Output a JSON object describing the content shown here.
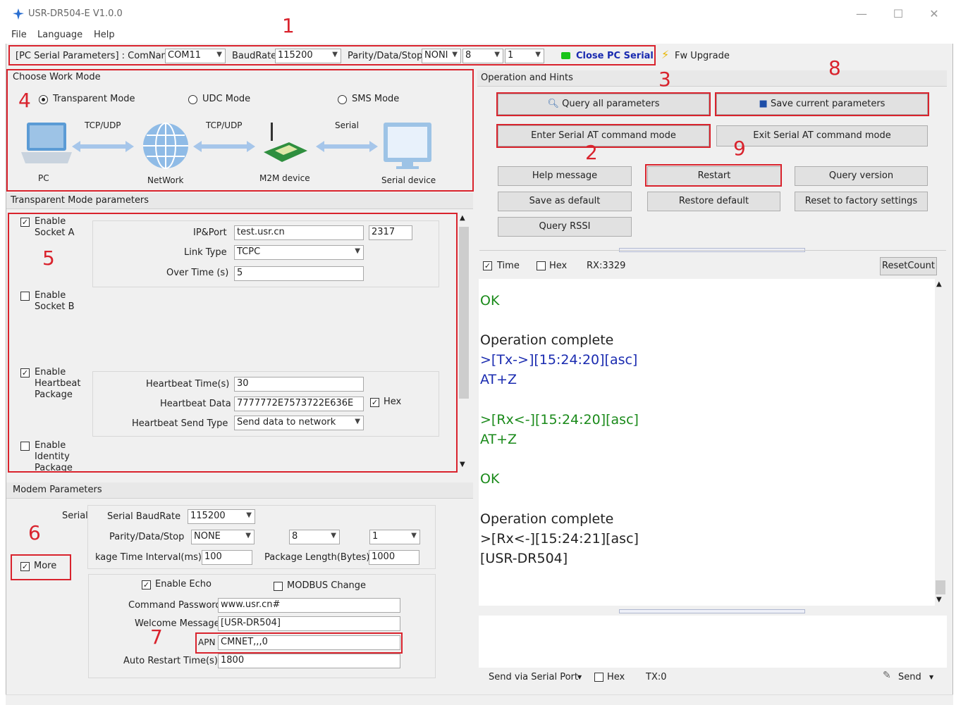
{
  "window": {
    "title": "USR-DR504-E V1.0.0",
    "min": "—",
    "max": "☐",
    "close": "✕"
  },
  "menu": [
    "File",
    "Language",
    "Help"
  ],
  "pcserial": {
    "label": "[PC Serial Parameters] : ComName",
    "comname": "COM11",
    "baud_label": "BaudRate",
    "baud": "115200",
    "pds_label": "Parity/Data/Stop",
    "parity": "NONI",
    "data": "8",
    "stop": "1",
    "close_btn": "Close PC Serial",
    "fw_upgrade": "Fw Upgrade"
  },
  "markers": [
    "1",
    "2",
    "3",
    "4",
    "5",
    "6",
    "7",
    "8",
    "9"
  ],
  "workmode": {
    "title": "Choose Work Mode",
    "modes": [
      "Transparent Mode",
      "UDC Mode",
      "SMS Mode"
    ],
    "selected": "Transparent Mode",
    "diagram": {
      "pc": "PC",
      "network": "NetWork",
      "m2m": "M2M device",
      "serial_dev": "Serial device",
      "link1": "TCP/UDP",
      "link2": "TCP/UDP",
      "link3": "Serial"
    }
  },
  "transparent": {
    "title": "Transparent Mode parameters",
    "socket_a": {
      "enable": "Enable",
      "name": "Socket A",
      "checked": true,
      "ipport_label": "IP&Port",
      "ip": "test.usr.cn",
      "port": "2317",
      "linktype_label": "Link Type",
      "linktype": "TCPC",
      "overtime_label": "Over Time (s)",
      "overtime": "5"
    },
    "socket_b": {
      "enable": "Enable",
      "name": "Socket B",
      "checked": false
    },
    "heartbeat": {
      "enable": "Enable",
      "name1": "Heartbeat",
      "name2": "Package",
      "checked": true,
      "time_label": "Heartbeat Time(s)",
      "time": "30",
      "data_label": "Heartbeat Data",
      "data": "7777772E7573722E636E",
      "hex_label": "Hex",
      "hex_checked": true,
      "sendtype_label": "Heartbeat Send Type",
      "sendtype": "Send data to network"
    },
    "identity": {
      "enable": "Enable",
      "name1": "Identity",
      "name2": "Package",
      "checked": false
    }
  },
  "modem": {
    "title": "Modem Parameters",
    "serial_label": "Serial",
    "more_label": "More",
    "more_checked": true,
    "baud_label": "Serial BaudRate",
    "baud": "115200",
    "pds_label": "Parity/Data/Stop",
    "parity": "NONE",
    "data": "8",
    "stop": "1",
    "interval_label": "kage Time Interval(ms)",
    "interval": "100",
    "pkglen_label": "Package Length(Bytes)",
    "pkglen": "1000",
    "echo_label": "Enable Echo",
    "echo_checked": true,
    "modbus_label": "MODBUS Change",
    "modbus_checked": false,
    "cmdpwd_label": "Command Password",
    "cmdpwd": "www.usr.cn#",
    "welcome_label": "Welcome Message",
    "welcome": "[USR-DR504]",
    "apn_label": "APN",
    "apn": "CMNET,,,0",
    "autorestart_label": "Auto Restart Time(s)",
    "autorestart": "1800"
  },
  "ops": {
    "title": "Operation and Hints",
    "query_all": "Query all parameters",
    "save_current": "Save current parameters",
    "enter_at": "Enter Serial AT command mode",
    "exit_at": "Exit Serial AT command mode",
    "help": "Help message",
    "restart": "Restart",
    "query_version": "Query version",
    "save_default": "Save as default",
    "restore_default": "Restore default",
    "reset_factory": "Reset to factory settings",
    "query_rssi": "Query RSSI"
  },
  "log": {
    "time_label": "Time",
    "time_checked": true,
    "hex_label": "Hex",
    "hex_checked": false,
    "rx": "RX:3329",
    "reset_count": "ResetCount",
    "lines": [
      {
        "text": "OK",
        "color": "green"
      },
      {
        "text": "",
        "color": "dark"
      },
      {
        "text": "Operation complete",
        "color": "dark"
      },
      {
        "text": ">[Tx->][15:24:20][asc]",
        "color": "blue"
      },
      {
        "text": "AT+Z",
        "color": "blue"
      },
      {
        "text": "",
        "color": "dark"
      },
      {
        "text": ">[Rx<-][15:24:20][asc]",
        "color": "green"
      },
      {
        "text": "AT+Z",
        "color": "green"
      },
      {
        "text": "",
        "color": "dark"
      },
      {
        "text": "OK",
        "color": "green"
      },
      {
        "text": "",
        "color": "dark"
      },
      {
        "text": "Operation complete",
        "color": "dark"
      },
      {
        "text": ">[Rx<-][15:24:21][asc]",
        "color": "dark"
      },
      {
        "text": "[USR-DR504]",
        "color": "dark"
      }
    ]
  },
  "sendbar": {
    "send_via": "Send via Serial Port",
    "hex_label": "Hex",
    "hex_checked": false,
    "tx": "TX:0",
    "send": "Send"
  }
}
